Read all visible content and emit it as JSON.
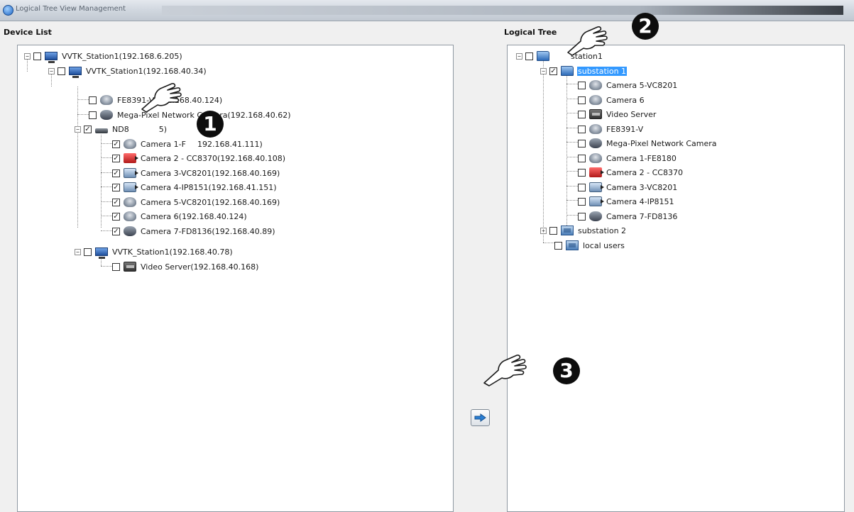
{
  "window": {
    "title": "Logical Tree View Management"
  },
  "device_list": {
    "label": "Device List",
    "nodes": [
      {
        "text": "VVTK_Station1(192.168.6.205)",
        "checked": false,
        "icon": "computer-icon"
      },
      {
        "text": "VVTK_Station1(192.168.40.34)",
        "checked": false,
        "icon": "computer-icon"
      },
      {
        "text": "FE8391-V(192.168.40.124)",
        "checked": false,
        "icon": "dome-camera-icon"
      },
      {
        "text": "Mega-Pixel Network Camera(192.168.40.62)",
        "checked": false,
        "icon": "speed-dome-icon"
      },
      {
        "text": "ND8",
        "text_suffix": "5)",
        "checked": true,
        "icon": "nvr-icon"
      },
      {
        "text": "Camera 1-F",
        "text_suffix": "192.168.41.111)",
        "checked": true,
        "icon": "dome-camera-icon"
      },
      {
        "text": "Camera 2 - CC8370(192.168.40.108)",
        "checked": true,
        "icon": "box-camera-red-icon"
      },
      {
        "text": "Camera 3-VC8201(192.168.40.169)",
        "checked": true,
        "icon": "box-camera-blue-icon"
      },
      {
        "text": "Camera 4-IP8151(192.168.41.151)",
        "checked": true,
        "icon": "box-camera-blue-icon"
      },
      {
        "text": "Camera 5-VC8201(192.168.40.169)",
        "checked": true,
        "icon": "dome-camera-icon"
      },
      {
        "text": "Camera 6(192.168.40.124)",
        "checked": true,
        "icon": "dome-camera-icon"
      },
      {
        "text": "Camera 7-FD8136(192.168.40.89)",
        "checked": true,
        "icon": "speed-dome-icon"
      },
      {
        "text": "VVTK_Station1(192.168.40.78)",
        "checked": false,
        "icon": "computer-icon"
      },
      {
        "text": "Video Server(192.168.40.168)",
        "checked": false,
        "icon": "video-server-icon"
      }
    ]
  },
  "logical_tree": {
    "label": "Logical Tree",
    "nodes": [
      {
        "text": "station1",
        "checked": false,
        "icon": "folder-open-icon"
      },
      {
        "text": "substation 1",
        "checked": true,
        "icon": "folder-open-icon",
        "selected": true
      },
      {
        "text": "Camera 5-VC8201",
        "checked": false,
        "icon": "dome-camera-icon"
      },
      {
        "text": "Camera 6",
        "checked": false,
        "icon": "dome-camera-icon"
      },
      {
        "text": "Video Server",
        "checked": false,
        "icon": "video-server-icon"
      },
      {
        "text": "FE8391-V",
        "checked": false,
        "icon": "dome-camera-icon"
      },
      {
        "text": "Mega-Pixel Network Camera",
        "checked": false,
        "icon": "speed-dome-icon"
      },
      {
        "text": "Camera 1-FE8180",
        "checked": false,
        "icon": "dome-camera-icon"
      },
      {
        "text": "Camera 2 - CC8370",
        "checked": false,
        "icon": "box-camera-red-icon"
      },
      {
        "text": "Camera 3-VC8201",
        "checked": false,
        "icon": "box-camera-blue-icon"
      },
      {
        "text": "Camera 4-IP8151",
        "checked": false,
        "icon": "box-camera-blue-icon"
      },
      {
        "text": "Camera 7-FD8136",
        "checked": false,
        "icon": "speed-dome-icon"
      },
      {
        "text": "substation 2",
        "checked": false,
        "icon": "folder-icon"
      },
      {
        "text": "local users",
        "checked": false,
        "icon": "folder-icon"
      }
    ]
  },
  "transfer_button": {
    "icon": "arrow-right-icon"
  },
  "callouts": [
    "1",
    "2",
    "3"
  ],
  "colors": {
    "selection": "#3399ff",
    "panel_border": "#8f98a2",
    "callout_bg": "#0d0d0d"
  }
}
